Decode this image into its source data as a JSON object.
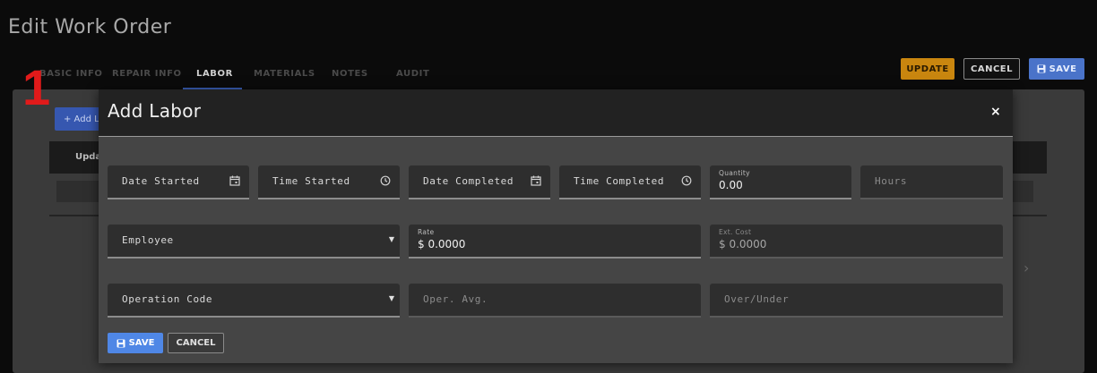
{
  "page": {
    "title": "Edit Work Order"
  },
  "tabs": [
    {
      "label": "BASIC INFO"
    },
    {
      "label": "REPAIR INFO"
    },
    {
      "label": "LABOR"
    },
    {
      "label": "MATERIALS"
    },
    {
      "label": "NOTES"
    },
    {
      "label": "AUDIT"
    }
  ],
  "toolbar": {
    "update_label": "UPDATE",
    "cancel_label": "CANCEL",
    "save_label": "SAVE"
  },
  "marker": "1",
  "background": {
    "add_button_label": "+ Add L",
    "table_header_text": "Upda"
  },
  "modal": {
    "title": "Add Labor",
    "close": "×",
    "fields": {
      "date_started": {
        "label": "Date Started"
      },
      "time_started": {
        "label": "Time Started"
      },
      "date_completed": {
        "label": "Date Completed"
      },
      "time_completed": {
        "label": "Time Completed"
      },
      "quantity": {
        "label": "Quantity",
        "value": "0.00"
      },
      "hours": {
        "label": "Hours"
      },
      "employee": {
        "label": "Employee"
      },
      "rate": {
        "label": "Rate",
        "value": "$ 0.0000"
      },
      "ext_cost": {
        "label": "Ext. Cost",
        "value": "$ 0.0000"
      },
      "operation_code": {
        "label": "Operation Code"
      },
      "oper_avg": {
        "label": "Oper. Avg."
      },
      "over_under": {
        "label": "Over/Under"
      }
    },
    "save_label": "SAVE",
    "cancel_label": "CANCEL"
  },
  "colors": {
    "accent_blue": "#4f87e6",
    "update_orange": "#c9860f",
    "marker_red": "#e11a1a"
  }
}
